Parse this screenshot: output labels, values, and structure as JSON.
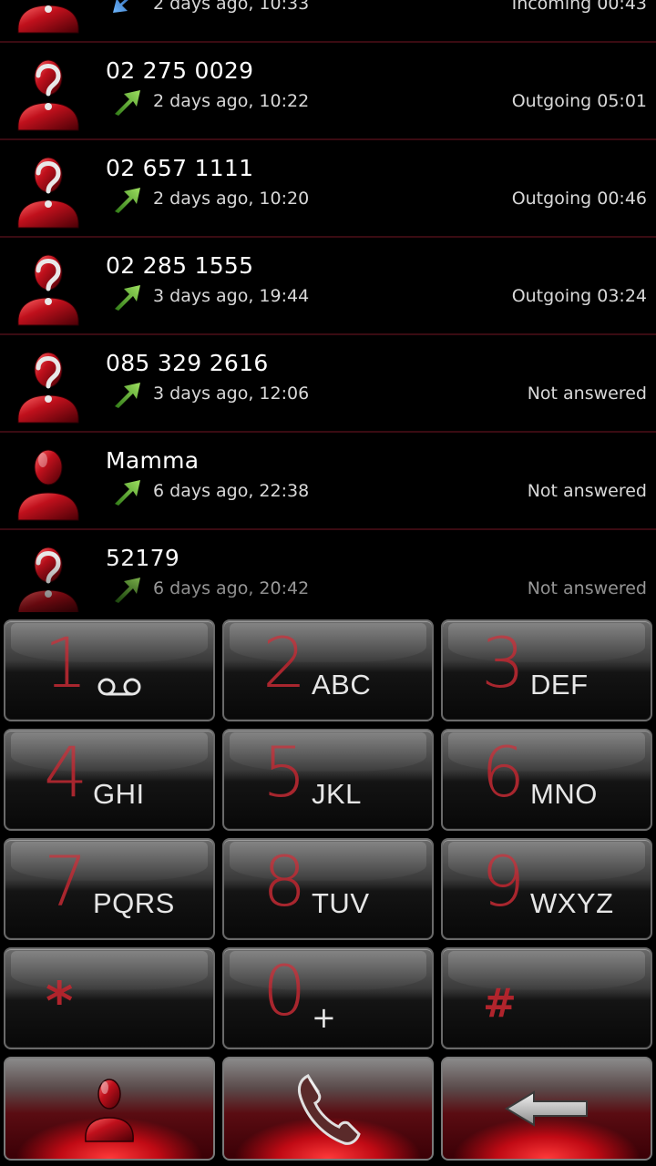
{
  "call_log": [
    {
      "name": "",
      "time": "2 days ago, 10:33",
      "status": "Incoming 00:43",
      "direction": "incoming",
      "avatar": "unknown-contact-icon"
    },
    {
      "name": "02 275 0029",
      "time": "2 days ago, 10:22",
      "status": "Outgoing 05:01",
      "direction": "outgoing",
      "avatar": "unknown-contact-icon"
    },
    {
      "name": "02 657 1111",
      "time": "2 days ago, 10:20",
      "status": "Outgoing 00:46",
      "direction": "outgoing",
      "avatar": "unknown-contact-icon"
    },
    {
      "name": "02 285 1555",
      "time": "3 days ago, 19:44",
      "status": "Outgoing 03:24",
      "direction": "outgoing",
      "avatar": "unknown-contact-icon"
    },
    {
      "name": "085 329 2616",
      "time": "3 days ago, 12:06",
      "status": "Not answered",
      "direction": "outgoing",
      "avatar": "unknown-contact-icon"
    },
    {
      "name": "Mamma",
      "time": "6 days ago, 22:38",
      "status": "Not answered",
      "direction": "outgoing",
      "avatar": "contact-icon"
    },
    {
      "name": "52179",
      "time": "6 days ago, 20:42",
      "status": "Not answered",
      "direction": "outgoing",
      "avatar": "unknown-contact-icon"
    }
  ],
  "dialpad": {
    "keys": [
      {
        "digit": "1",
        "letters": "",
        "icon": "voicemail-icon"
      },
      {
        "digit": "2",
        "letters": "ABC"
      },
      {
        "digit": "3",
        "letters": "DEF"
      },
      {
        "digit": "4",
        "letters": "GHI"
      },
      {
        "digit": "5",
        "letters": "JKL"
      },
      {
        "digit": "6",
        "letters": "MNO"
      },
      {
        "digit": "7",
        "letters": "PQRS"
      },
      {
        "digit": "8",
        "letters": "TUV"
      },
      {
        "digit": "9",
        "letters": "WXYZ"
      },
      {
        "digit": "*",
        "letters": ""
      },
      {
        "digit": "0",
        "letters": "+"
      },
      {
        "digit": "#",
        "letters": ""
      }
    ],
    "actions": [
      "contacts-icon",
      "phone-call-icon",
      "backspace-icon"
    ]
  },
  "colors": {
    "accent_red": "#a8262e",
    "row_divider": "#3a0b12",
    "arrow_outgoing": "#6fc23a",
    "arrow_incoming": "#2f7fd8"
  }
}
